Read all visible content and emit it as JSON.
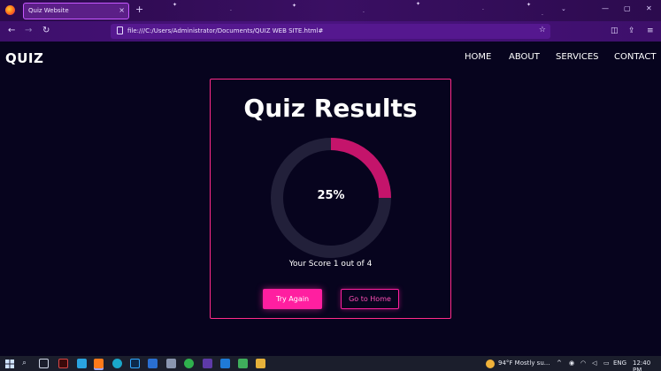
{
  "browser": {
    "tab_title": "Quiz Website",
    "tab_close": "×",
    "new_tab": "+",
    "list_tabs": "⌄",
    "window_min": "—",
    "window_max": "▢",
    "window_close": "✕",
    "back": "←",
    "forward": "→",
    "reload": "↻",
    "url": "file:///C:/Users/Administrator/Documents/QUIZ WEB SITE.html#",
    "bookmark": "☆",
    "pocket": "◫",
    "extensions": "⇪",
    "menu": "≡"
  },
  "site": {
    "brand": "QUIZ",
    "nav": [
      "HOME",
      "ABOUT",
      "SERVICES",
      "CONTACT"
    ]
  },
  "results": {
    "title": "Quiz Results",
    "percent_label": "25%",
    "score_fraction": 0.25,
    "score_text": "Your Score 1 out of 4",
    "try_again": "Try Again",
    "go_home": "Go to Home"
  },
  "colors": {
    "accent": "#ff1fa0",
    "ring_fill": "#c4146b",
    "ring_track": "#22203a",
    "page_bg": "#07041e"
  },
  "taskbar": {
    "start_icon": "windows-icon",
    "search": "⌕",
    "weather": "94°F  Mostly su...",
    "tray_arrow": "^",
    "lang": "ENG",
    "time": "12:40 PM"
  }
}
